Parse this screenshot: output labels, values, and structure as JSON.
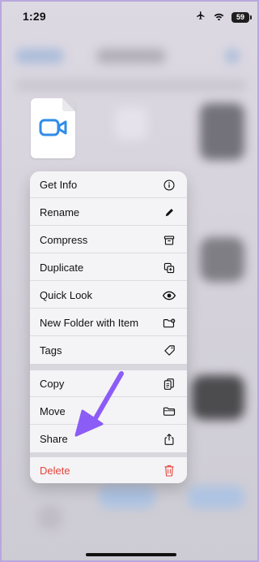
{
  "status_bar": {
    "time": "1:29",
    "battery": "59"
  },
  "file": {
    "icon": "video-camera-icon",
    "accent": "#2f8ce8"
  },
  "menu": {
    "items": [
      {
        "label": "Get Info",
        "icon": "info-circle-icon"
      },
      {
        "label": "Rename",
        "icon": "pencil-icon"
      },
      {
        "label": "Compress",
        "icon": "archive-box-icon"
      },
      {
        "label": "Duplicate",
        "icon": "duplicate-icon"
      },
      {
        "label": "Quick Look",
        "icon": "eye-icon"
      },
      {
        "label": "New Folder with Item",
        "icon": "folder-badge-icon"
      },
      {
        "label": "Tags",
        "icon": "tag-icon"
      },
      {
        "label": "Copy",
        "icon": "copy-doc-icon"
      },
      {
        "label": "Move",
        "icon": "folder-icon"
      },
      {
        "label": "Share",
        "icon": "share-icon"
      },
      {
        "label": "Delete",
        "icon": "trash-icon"
      }
    ]
  },
  "annotation": {
    "arrow_color": "#8b5cf6"
  },
  "colors": {
    "destructive": "#e5443b"
  }
}
